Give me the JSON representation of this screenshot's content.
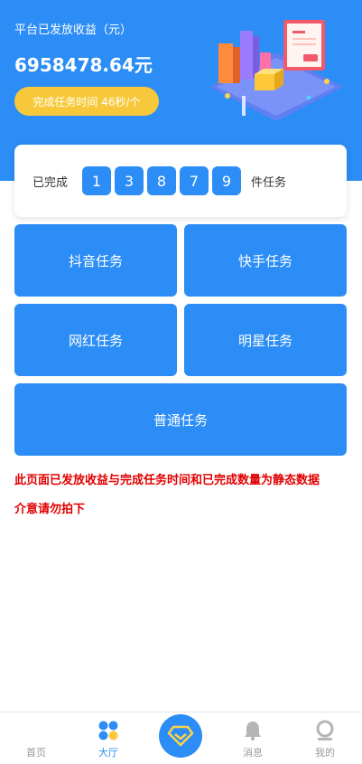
{
  "header": {
    "title": "平台已发放收益（元）",
    "amount": "6958478.64元",
    "pill": "完成任务时间 46秒/个"
  },
  "counter": {
    "prefix": "已完成",
    "digits": [
      "1",
      "3",
      "8",
      "7",
      "9"
    ],
    "suffix": "件任务"
  },
  "tasks": {
    "douyin": "抖音任务",
    "kuaishou": "快手任务",
    "wanghong": "网红任务",
    "mingxing": "明星任务",
    "putong": "普通任务"
  },
  "notice": {
    "line1": "此页面已发放收益与完成任务时间和已完成数量为静态数据",
    "line2": "介意请勿拍下"
  },
  "tabbar": {
    "home": "首页",
    "hall": "大厅",
    "messages": "消息",
    "mine": "我的",
    "icons": [
      "home-icon",
      "grid-icon",
      "diamond-icon",
      "bell-icon",
      "user-icon"
    ]
  },
  "colors": {
    "primary": "#2b8df5",
    "pill": "#f7c93a",
    "warning": "#e00000",
    "inactive": "#999999"
  }
}
